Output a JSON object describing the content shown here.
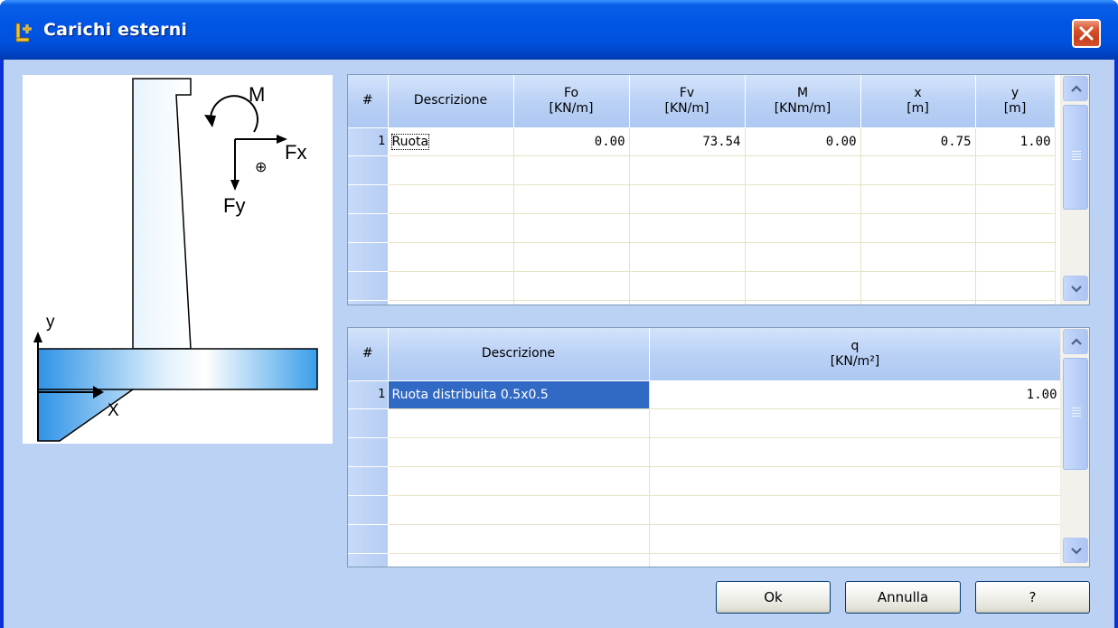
{
  "window": {
    "title": "Carichi esterni"
  },
  "drawing": {
    "label_m": "M",
    "label_fx": "Fx",
    "label_fy": "Fy",
    "label_y": "y",
    "label_x": "X",
    "sign_symbol": "⊕"
  },
  "loads_table": {
    "headers": [
      {
        "line1": "#",
        "line2": ""
      },
      {
        "line1": "Descrizione",
        "line2": ""
      },
      {
        "line1": "Fo",
        "line2": "[KN/m]"
      },
      {
        "line1": "Fv",
        "line2": "[KN/m]"
      },
      {
        "line1": "M",
        "line2": "[KNm/m]"
      },
      {
        "line1": "x",
        "line2": "[m]"
      },
      {
        "line1": "y",
        "line2": "[m]"
      }
    ],
    "rows": [
      {
        "num": "1",
        "descrizione": "Ruota",
        "fo": "0.00",
        "fv": "73.54",
        "m": "0.00",
        "x": "0.75",
        "y": "1.00"
      }
    ]
  },
  "distributed_table": {
    "headers": [
      {
        "line1": "#",
        "line2": ""
      },
      {
        "line1": "Descrizione",
        "line2": ""
      },
      {
        "line1": "q",
        "line2": "[KN/m²]"
      }
    ],
    "rows": [
      {
        "num": "1",
        "descrizione": "Ruota distribuita 0.5x0.5",
        "q": "1.00"
      }
    ]
  },
  "buttons": {
    "ok": "Ok",
    "annulla": "Annulla",
    "help": "?"
  },
  "colors": {
    "titlebar": "#0055e5",
    "client_bg": "#bcd2f5",
    "selection": "#316ac5",
    "wall_fill": "#3a9ee8"
  }
}
